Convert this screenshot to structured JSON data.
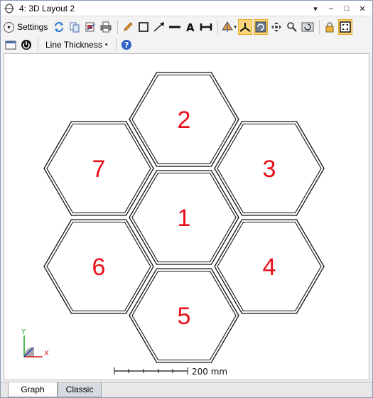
{
  "window": {
    "title": "4: 3D Layout 2",
    "controls": {
      "pin": "▾",
      "minimize": "–",
      "maximize": "□",
      "close": "✕"
    }
  },
  "toolbar": {
    "settings_label": "Settings",
    "line_thickness_label": "Line Thickness",
    "icons": [
      "refresh-icon",
      "copy-icon",
      "export-icon",
      "print-icon",
      "pencil-icon",
      "rectangle-icon",
      "arrow-icon",
      "line-icon",
      "text-icon",
      "dimension-icon",
      "view-rotate-icon",
      "axes-icon",
      "rotate-icon",
      "pan-icon",
      "zoom-icon",
      "reset-icon",
      "lock-icon",
      "fit-icon",
      "window-icon",
      "power-icon",
      "help-icon"
    ]
  },
  "figure": {
    "hexagons": [
      {
        "label": "1"
      },
      {
        "label": "2"
      },
      {
        "label": "3"
      },
      {
        "label": "4"
      },
      {
        "label": "5"
      },
      {
        "label": "6"
      },
      {
        "label": "7"
      }
    ],
    "label_color": "#e8101a",
    "scale_bar_label": "200 mm",
    "axes": {
      "y": "Y",
      "x": "X",
      "y_color": "#1ca01c",
      "x_color": "#d01818",
      "z_color": "#2030c0"
    }
  },
  "tabs": [
    {
      "label": "Graph",
      "selected": true
    },
    {
      "label": "Classic",
      "selected": false
    }
  ]
}
